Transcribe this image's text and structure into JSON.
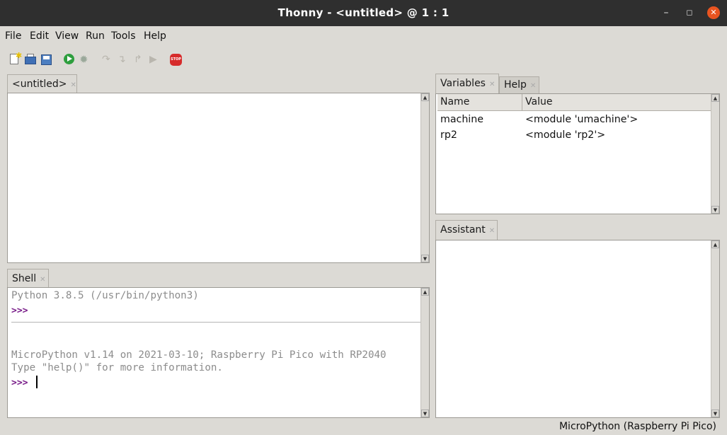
{
  "window": {
    "title": "Thonny  -  <untitled>  @  1 : 1"
  },
  "menu": [
    "File",
    "Edit",
    "View",
    "Run",
    "Tools",
    "Help"
  ],
  "toolbar": {
    "icons": [
      "new-file-icon",
      "open-file-icon",
      "save-file-icon",
      "run-icon",
      "debug-icon",
      "step-over-icon",
      "step-into-icon",
      "step-out-icon",
      "resume-icon",
      "stop-icon"
    ],
    "stop_label": "STOP"
  },
  "editor": {
    "tab_label": "<untitled>",
    "content": ""
  },
  "shell": {
    "tab_label": "Shell",
    "lines": [
      "Python 3.8.5 (/usr/bin/python3)",
      ">>>",
      "MicroPython v1.14 on 2021-03-10; Raspberry Pi Pico with RP2040",
      "Type \"help()\" for more information.",
      ">>>"
    ],
    "prompt_color": "#7a1f8a"
  },
  "variables": {
    "tabs": [
      "Variables",
      "Help"
    ],
    "columns": [
      "Name",
      "Value"
    ],
    "rows": [
      {
        "name": "machine",
        "value": "<module 'umachine'>"
      },
      {
        "name": "rp2",
        "value": "<module 'rp2'>"
      }
    ]
  },
  "assistant": {
    "tab_label": "Assistant",
    "content": ""
  },
  "status": {
    "interpreter": "MicroPython (Raspberry Pi Pico)"
  },
  "colors": {
    "titlebar": "#2f2f2f",
    "close_button": "#e95420",
    "run_icon": "#2e9e3e",
    "stop_icon": "#d62b2b"
  }
}
